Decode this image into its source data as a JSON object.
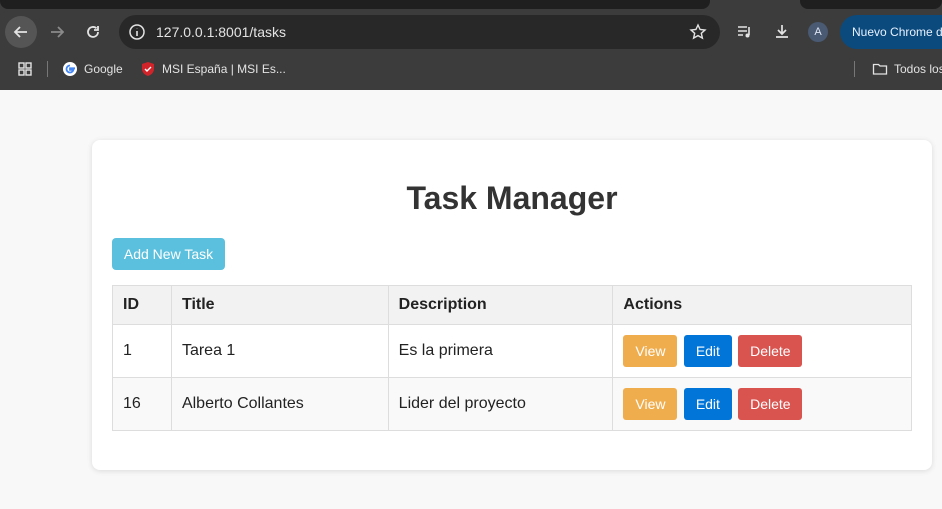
{
  "browser": {
    "url": "127.0.0.1:8001/tasks",
    "avatar_letter": "A",
    "promo_label": "Nuevo Chrome d",
    "bookmarks": [
      "Google",
      "MSI España | MSI Es...",
      "Todos los"
    ]
  },
  "page": {
    "title": "Task Manager",
    "add_button": "Add New Task",
    "table": {
      "headers": [
        "ID",
        "Title",
        "Description",
        "Actions"
      ],
      "rows": [
        {
          "id": "1",
          "title": "Tarea 1",
          "description": "Es la primera"
        },
        {
          "id": "16",
          "title": "Alberto Collantes",
          "description": "Lider del proyecto"
        }
      ],
      "actions": {
        "view": "View",
        "edit": "Edit",
        "delete": "Delete"
      }
    }
  },
  "colors": {
    "add_button": "#5bc0de",
    "view_button": "#f0ad4e",
    "edit_button": "#0275d8",
    "delete_button": "#d9534f"
  }
}
